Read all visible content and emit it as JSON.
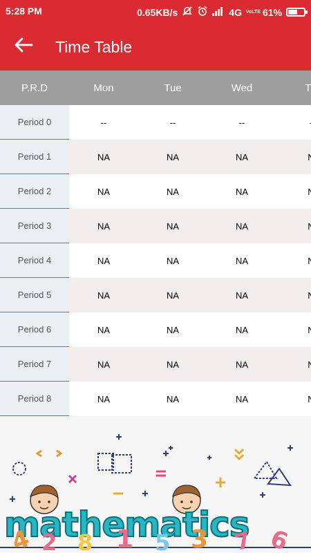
{
  "status_bar": {
    "time": "5:28 PM",
    "speed": "0.65KB/s",
    "network": "4G",
    "volte": "VoLTE",
    "battery": "61%",
    "battery_level": 0.61,
    "icons": [
      "mute-icon",
      "alarm-icon",
      "signal-icon",
      "battery-icon"
    ]
  },
  "app_bar": {
    "title": "Time Table",
    "back_icon": "arrow-left-icon",
    "color": "#d92b31"
  },
  "table": {
    "header_color": "#9e9e9e",
    "columns": [
      "P.R.D",
      "Mon",
      "Tue",
      "Wed",
      "Th"
    ],
    "rows": [
      {
        "period": "Period 0",
        "cells": [
          "--",
          "--",
          "--",
          "-"
        ]
      },
      {
        "period": "Period 1",
        "cells": [
          "NA",
          "NA",
          "NA",
          "N"
        ]
      },
      {
        "period": "Period 2",
        "cells": [
          "NA",
          "NA",
          "NA",
          "N"
        ]
      },
      {
        "period": "Period 3",
        "cells": [
          "NA",
          "NA",
          "NA",
          "N"
        ]
      },
      {
        "period": "Period 4",
        "cells": [
          "NA",
          "NA",
          "NA",
          "N"
        ]
      },
      {
        "period": "Period 5",
        "cells": [
          "NA",
          "NA",
          "NA",
          "N"
        ]
      },
      {
        "period": "Period 6",
        "cells": [
          "NA",
          "NA",
          "NA",
          "N"
        ]
      },
      {
        "period": "Period 7",
        "cells": [
          "NA",
          "NA",
          "NA",
          "N"
        ]
      },
      {
        "period": "Period 8",
        "cells": [
          "NA",
          "NA",
          "NA",
          "N"
        ]
      }
    ]
  },
  "banner": {
    "word": "mathematics",
    "digits": [
      "4",
      "2",
      "8",
      "1",
      "5",
      "3",
      "7",
      "6"
    ]
  }
}
